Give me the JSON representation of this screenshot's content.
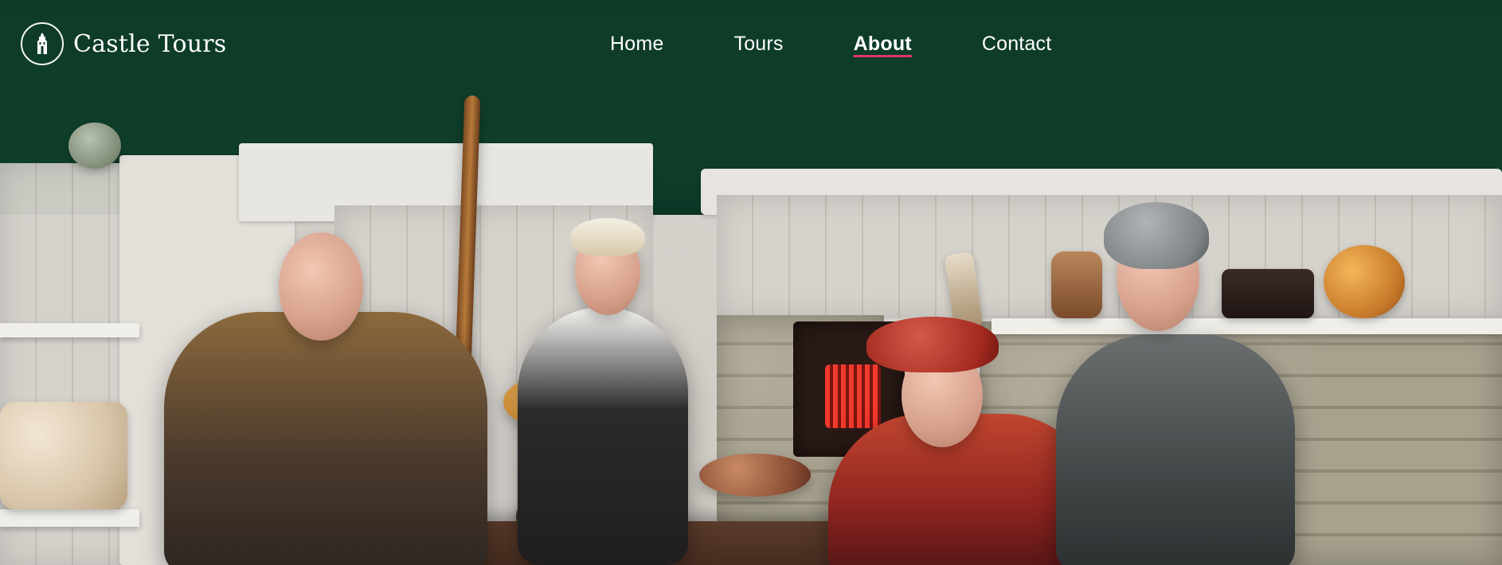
{
  "header": {
    "brand": {
      "name": "Castle Tours",
      "icon": "castle-icon"
    },
    "nav": {
      "items": [
        {
          "label": "Home",
          "active": false
        },
        {
          "label": "Tours",
          "active": false
        },
        {
          "label": "About",
          "active": true
        },
        {
          "label": "Contact",
          "active": false
        }
      ]
    }
  },
  "theme": {
    "accent": "#e2336b",
    "text": "#ffffff",
    "wall_green": "#0e3b28"
  },
  "hero": {
    "alt": ""
  }
}
